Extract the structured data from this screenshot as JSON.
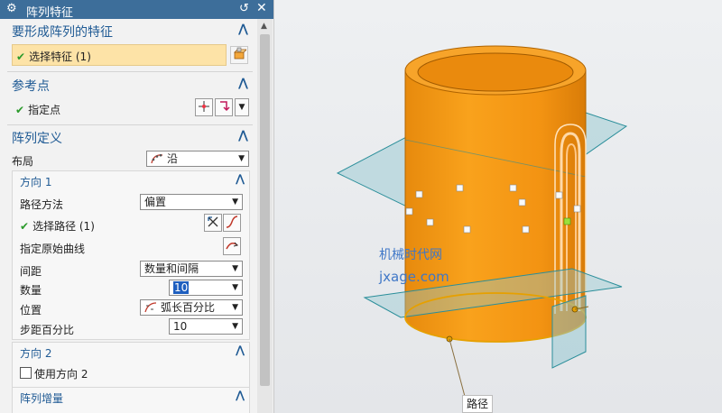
{
  "panel": {
    "title": "阵列特征",
    "icons": {
      "settings": "gear-icon",
      "reset": "reset-icon",
      "close": "close-icon"
    }
  },
  "features_section": {
    "title": "要形成阵列的特征",
    "select_feature_label": "选择特征 (1)"
  },
  "reference_section": {
    "title": "参考点",
    "specify_point_label": "指定点"
  },
  "pattern_def_section": {
    "title": "阵列定义",
    "layout_label": "布局",
    "layout_value": "沿"
  },
  "direction1": {
    "title": "方向 1",
    "path_method_label": "路径方法",
    "path_method_value": "偏置",
    "select_path_label": "选择路径 (1)",
    "specify_curve_label": "指定原始曲线",
    "spacing_label": "间距",
    "spacing_value": "数量和间隔",
    "count_label": "数量",
    "count_value": "10",
    "position_label": "位置",
    "position_value": "弧长百分比",
    "step_label": "步距百分比",
    "step_value": "10"
  },
  "direction2": {
    "title": "方向 2",
    "use_direction2_label": "使用方向 2"
  },
  "increment_section": {
    "title": "阵列增量"
  },
  "viewport": {
    "watermark_cn": "机械时代网",
    "watermark_en": "jxage.com",
    "path_label": "路径"
  },
  "colors": {
    "titlebar": "#3d6e9a",
    "section_title": "#1f5a94",
    "selected_row": "#fde3a7",
    "cylinder": "#f2930f",
    "plane": "#7fb9c3",
    "check": "#2b9a2b"
  }
}
